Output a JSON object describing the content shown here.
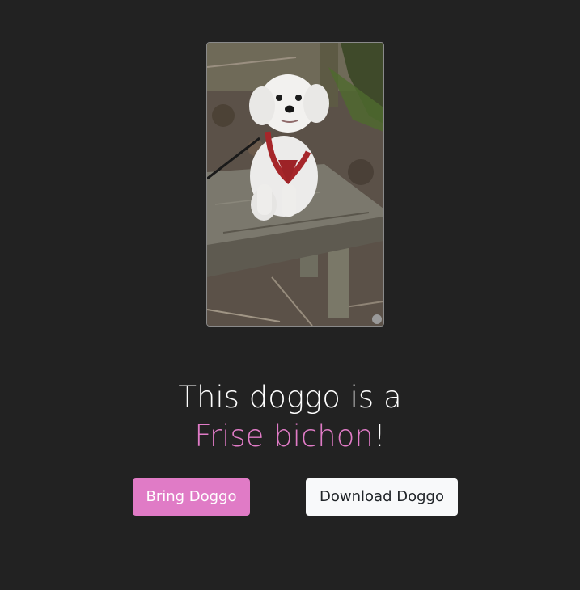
{
  "image": {
    "alt": "Dog photo",
    "icon": "dog-photo"
  },
  "caption": {
    "prefix": "This doggo is a",
    "breed": "Frise bichon",
    "suffix": "!"
  },
  "buttons": {
    "bring_label": "Bring Doggo",
    "download_label": "Download Doggo"
  },
  "colors": {
    "background": "#222222",
    "accent": "#e07bc6",
    "light_button": "#f8f9fa"
  }
}
